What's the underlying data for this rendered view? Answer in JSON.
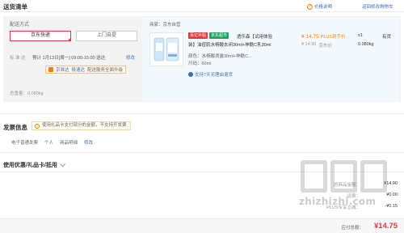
{
  "header": {
    "title": "送货清单",
    "price_note": "价格说明",
    "back_link": "返回修改购物车"
  },
  "delivery": {
    "section_label": "配送方式",
    "options": [
      {
        "label": "京东快递",
        "selected": true
      },
      {
        "label": "上门自提",
        "selected": false
      }
    ],
    "schedule_prefix": "标 准 达",
    "schedule_text": "预计 1月13日[周一] 09:00-15:00 送达",
    "modify_link": "修改",
    "upgrade": {
      "options": [
        "京准达",
        "极速达"
      ],
      "label": "配送服务全面升级"
    },
    "weight_label": "总重量：0.080kg"
  },
  "product": {
    "merchant": "商家：京东自营",
    "tags": [
      {
        "text": "百亿补贴",
        "color": "#e4393c"
      },
      {
        "text": "京东超市",
        "color": "#1aa260"
      }
    ],
    "name_line1": "透乐森【试用体验",
    "name_line2": "装】油痘肌水杨酸去闭30ml+神酰C乳30ml",
    "color": "颜色：水杨酸滴露30ml+神酰C...",
    "size": "尺码：60ml",
    "service": "支持7天无理由退货",
    "price": "¥ 14.75",
    "plus_note": "PLUS到手价",
    "orig_price": "¥ 14.90",
    "orig_note": "京东价",
    "qty": "x1",
    "stock": "有货",
    "weight": "0.080kg"
  },
  "invoice": {
    "title": "发票信息",
    "notice": "使用礼品卡支付部分的金额，不支持开发票",
    "type": "电子普通发票",
    "sep": "个人",
    "category": "商品明细",
    "modify": "修改"
  },
  "discount": {
    "title": "使用优惠/礼品卡/抵用"
  },
  "totals": {
    "rows": [
      {
        "label": "总商品金额：",
        "value": "¥14.90"
      },
      {
        "label": "运费：",
        "value": "¥0.00"
      },
      {
        "label": "PLUS专享立减：",
        "value": "-¥0.15"
      }
    ],
    "due_label": "应付总额：",
    "due_value": "¥14.75"
  },
  "watermark": {
    "site": "zhizhizhi.com"
  },
  "colors": {
    "accent_red": "#e4393c",
    "link_blue": "#3b6fb6",
    "panel_blue": "#f3f8fc"
  }
}
